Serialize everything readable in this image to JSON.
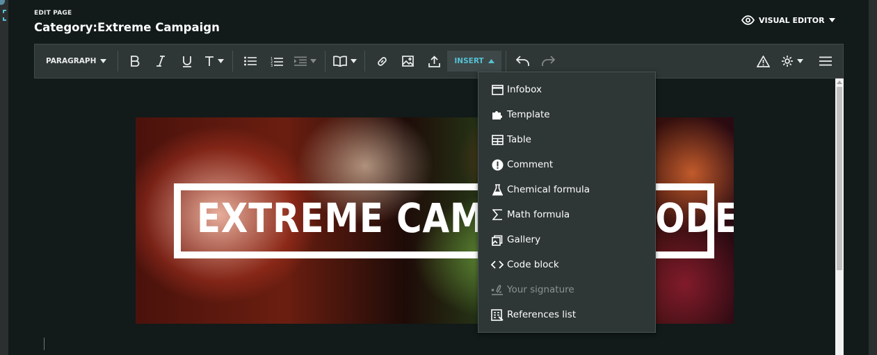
{
  "header": {
    "edit_label": "EDIT PAGE",
    "page_title": "Category:Extreme Campaign",
    "visual_editor_label": "VISUAL EDITOR"
  },
  "toolbar": {
    "paragraph_label": "PARAGRAPH",
    "insert_label": "INSERT"
  },
  "insert_menu": {
    "items": [
      {
        "label": "Infobox",
        "icon": "infobox-icon"
      },
      {
        "label": "Template",
        "icon": "puzzle-icon"
      },
      {
        "label": "Table",
        "icon": "table-icon"
      },
      {
        "label": "Comment",
        "icon": "comment-icon"
      },
      {
        "label": "Chemical formula",
        "icon": "flask-icon"
      },
      {
        "label": "Math formula",
        "icon": "sigma-icon"
      },
      {
        "label": "Gallery",
        "icon": "gallery-icon"
      },
      {
        "label": "Code block",
        "icon": "code-icon"
      },
      {
        "label": "Your signature",
        "icon": "signature-icon"
      },
      {
        "label": "References list",
        "icon": "references-icon"
      }
    ]
  },
  "content": {
    "banner_text": "EXTREME CAMPAIGN MODE"
  },
  "colors": {
    "background": "#121a1a",
    "toolbar": "#2f3636",
    "accent": "#55c1d4",
    "text": "#ffffff"
  }
}
